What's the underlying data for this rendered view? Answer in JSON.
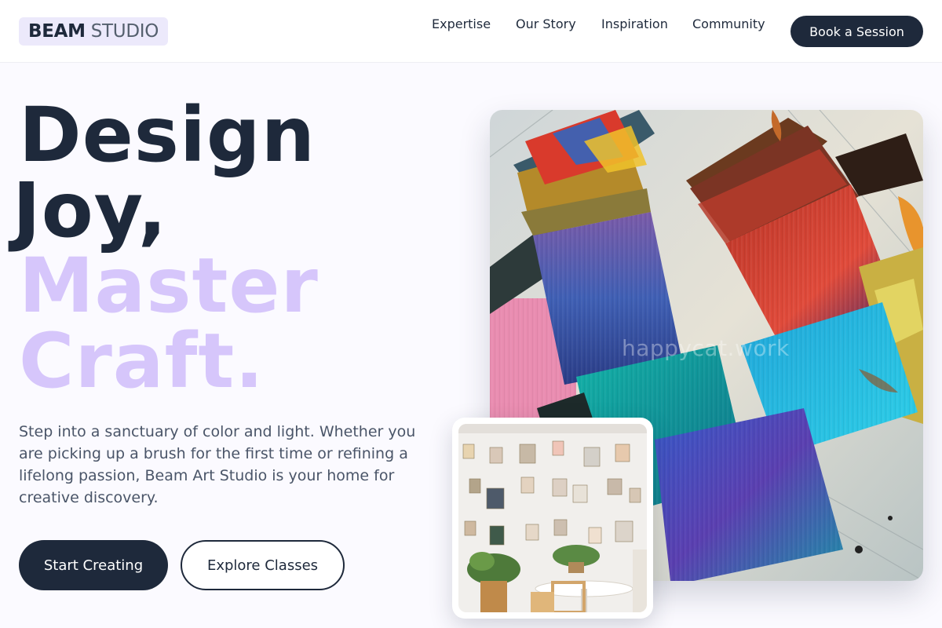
{
  "header": {
    "logo_strong": "BEAM",
    "logo_light": "STUDIO",
    "nav": [
      "Expertise",
      "Our Story",
      "Inspiration",
      "Community"
    ],
    "cta": "Book a Session"
  },
  "hero": {
    "line1": "Design",
    "line2": "Joy,",
    "line3": "Master",
    "line4": "Craft.",
    "description": "Step into a sanctuary of color and light. Whether you are picking up a brush for the first time or refining a lifelong passion, Beam Art Studio is your home for creative discovery.",
    "primary_button": "Start Creating",
    "secondary_button": "Explore Classes"
  },
  "images": {
    "watermark": "happycat.work"
  },
  "colors": {
    "primary": "#1e293b",
    "accent_lavender": "#d6c6fb",
    "logo_background": "#ece9fb",
    "page_background": "#fbfaff"
  }
}
